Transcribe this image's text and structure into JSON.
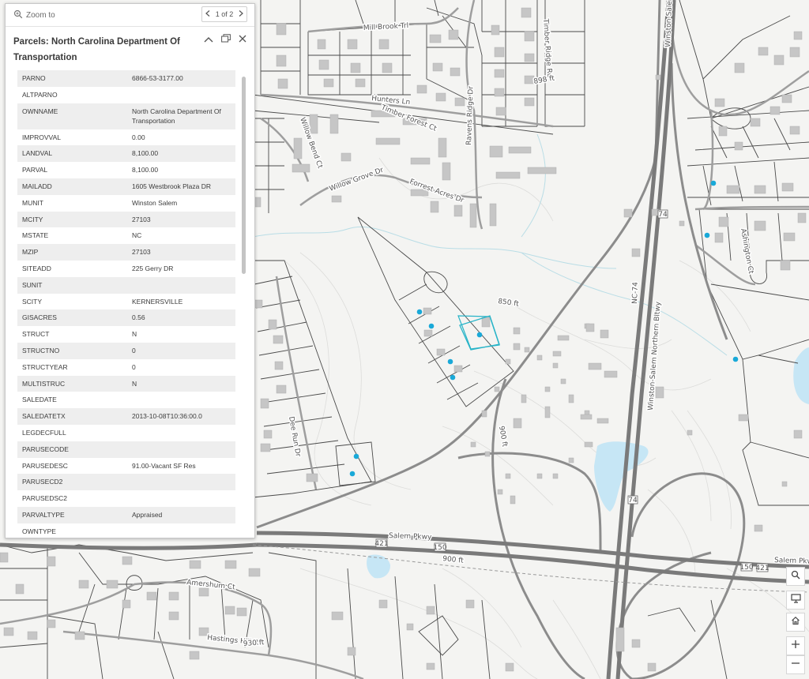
{
  "popup": {
    "zoom_to": "Zoom to",
    "pager": "1 of 2",
    "title": "Parcels: North Carolina Department Of Transportation",
    "attributes": [
      {
        "key": "PARNO",
        "value": "6866-53-3177.00"
      },
      {
        "key": "ALTPARNO",
        "value": ""
      },
      {
        "key": "OWNNAME",
        "value": "North Carolina Department Of Transportation"
      },
      {
        "key": "IMPROVVAL",
        "value": "0.00"
      },
      {
        "key": "LANDVAL",
        "value": "8,100.00"
      },
      {
        "key": "PARVAL",
        "value": "8,100.00"
      },
      {
        "key": "MAILADD",
        "value": "1605 Westbrook Plaza DR"
      },
      {
        "key": "MUNIT",
        "value": "Winston Salem"
      },
      {
        "key": "MCITY",
        "value": "27103"
      },
      {
        "key": "MSTATE",
        "value": "NC"
      },
      {
        "key": "MZIP",
        "value": "27103"
      },
      {
        "key": "SITEADD",
        "value": "225 Gerry DR"
      },
      {
        "key": "SUNIT",
        "value": ""
      },
      {
        "key": "SCITY",
        "value": "KERNERSVILLE"
      },
      {
        "key": "GISACRES",
        "value": "0.56"
      },
      {
        "key": "STRUCT",
        "value": "N"
      },
      {
        "key": "STRUCTNO",
        "value": "0"
      },
      {
        "key": "STRUCTYEAR",
        "value": "0"
      },
      {
        "key": "MULTISTRUC",
        "value": "N"
      },
      {
        "key": "SALEDATE",
        "value": ""
      },
      {
        "key": "SALEDATETX",
        "value": "2013-10-08T10:36:00.0"
      },
      {
        "key": "LEGDECFULL",
        "value": ""
      },
      {
        "key": "PARUSECODE",
        "value": ""
      },
      {
        "key": "PARUSEDESC",
        "value": "91.00-Vacant SF Res"
      },
      {
        "key": "PARUSECD2",
        "value": ""
      },
      {
        "key": "PARUSEDSC2",
        "value": ""
      },
      {
        "key": "PARVALTYPE",
        "value": "Appraised"
      },
      {
        "key": "OWNTYPE",
        "value": ""
      }
    ]
  },
  "map": {
    "labels": {
      "mill_brook": "Mill Brook Trl",
      "timber_ridge": "Timber Ridge Rd",
      "winston_salem_top": "Winston-Salem",
      "hunters": "Hunters Ln",
      "timber_forest": "Timber Forest Ct",
      "ravens_ridge": "Ravens Ridge Dr",
      "willow_bend": "Willow Bend Ct",
      "willow_grove": "Willow Grove Dr",
      "forrest_acres": "Forrest Acres Dr",
      "ashington": "Ashington Ct",
      "dee_run": "Dee Run Dr",
      "nc74": "NC-74",
      "winston_salem_northern": "Winston-Salem Northern Bltwy",
      "salem_pkwy_1": "Salem Pkwy",
      "salem_pkwy_2": "Salem Pkwy",
      "amershum": "Amershum Ct",
      "hastings_hill": "Hastings Hill Rd",
      "contour_896": "898 ft",
      "contour_850": "850 ft",
      "contour_900": "900 ft",
      "contour_900b": "900 ft",
      "contour_930": "930 ft",
      "shield_74a": "74",
      "shield_74b": "74",
      "shield_421a": "421",
      "shield_421b": "421",
      "shield_150a": "150",
      "shield_150b": "150"
    }
  },
  "colors": {
    "highlight": "#28b4c8",
    "point": "#19a9d8",
    "water": "#c6e6f5"
  }
}
